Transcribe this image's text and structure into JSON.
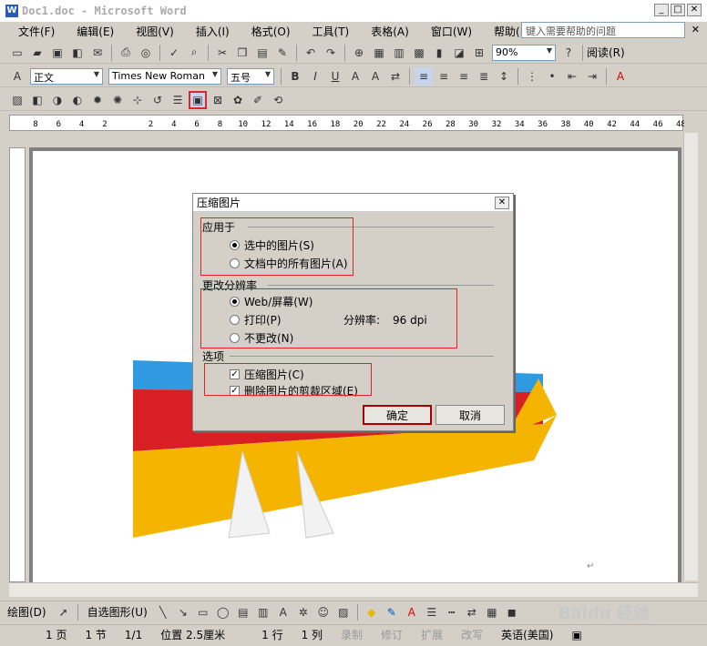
{
  "window": {
    "title": "Doc1.doc - Microsoft Word",
    "app_icon": "W"
  },
  "menu": [
    "文件(F)",
    "编辑(E)",
    "视图(V)",
    "插入(I)",
    "格式(O)",
    "工具(T)",
    "表格(A)",
    "窗口(W)",
    "帮助(H)"
  ],
  "help_search": {
    "placeholder": "键入需要帮助的问题"
  },
  "toolbar": {
    "zoom": "90%",
    "read_label": "阅读(R)"
  },
  "format": {
    "style": "正文",
    "font": "Times New Roman",
    "size": "五号"
  },
  "ruler": {
    "ticks": [
      "8",
      "6",
      "4",
      "2",
      "",
      "2",
      "4",
      "6",
      "8",
      "10",
      "12",
      "14",
      "16",
      "18",
      "20",
      "22",
      "24",
      "26",
      "28",
      "30",
      "32",
      "34",
      "36",
      "38",
      "40",
      "42",
      "44",
      "46",
      "48"
    ]
  },
  "dialog": {
    "title": "压缩图片",
    "group_apply": "应用于",
    "apply_selected": "选中的图片(S)",
    "apply_all": "文档中的所有图片(A)",
    "group_resolution": "更改分辨率",
    "res_web": "Web/屏幕(W)",
    "res_print": "打印(P)",
    "res_none": "不更改(N)",
    "res_label": "分辨率:",
    "res_value": "96 dpi",
    "group_options": "选项",
    "opt_compress": "压缩图片(C)",
    "opt_delete_crop": "删除图片的剪裁区域(E)",
    "ok": "确定",
    "cancel": "取消"
  },
  "drawbar": {
    "draw": "绘图(D)",
    "autoshape": "自选图形(U)"
  },
  "status": {
    "page": "1 页",
    "section": "1 节",
    "pages": "1/1",
    "position": "位置 2.5厘米",
    "line": "1 行",
    "col": "1 列",
    "rec": "录制",
    "trk": "修订",
    "ext": "扩展",
    "ovr": "改写",
    "lang": "英语(美国)"
  },
  "watermark": "Baidu 经验"
}
